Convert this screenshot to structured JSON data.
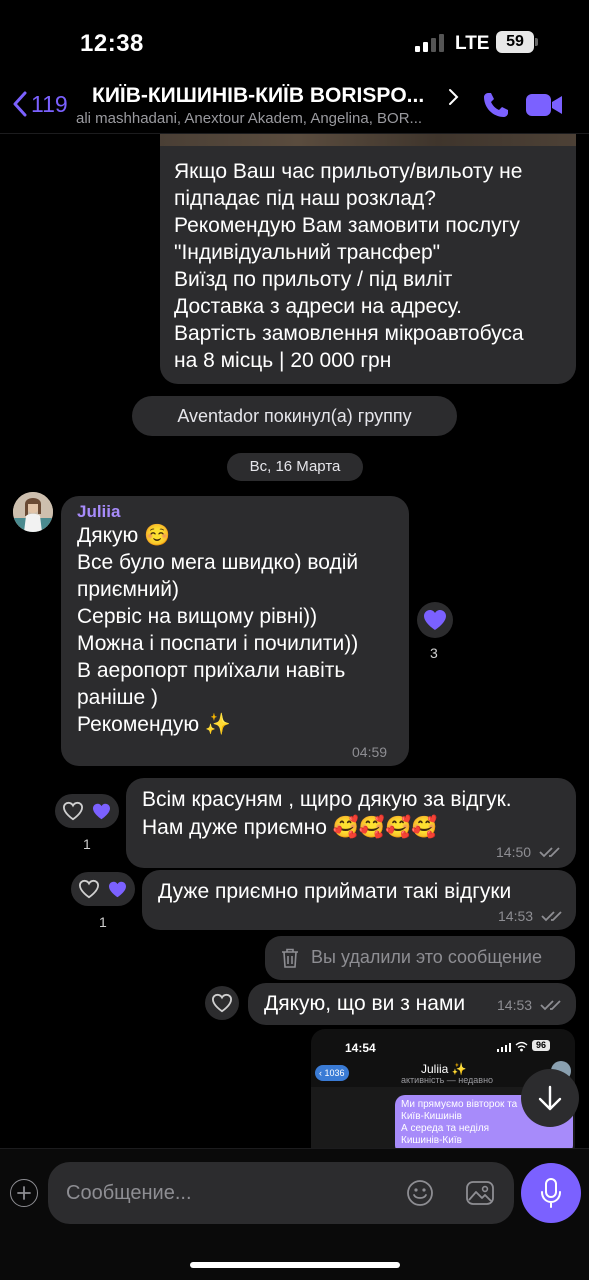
{
  "status_bar": {
    "time": "12:38",
    "network": "LTE",
    "battery": "59"
  },
  "header": {
    "back_count": "119",
    "title": "КИЇВ-КИШИНІВ-КИЇВ BORISPO...",
    "participants": "ali mashhadani, Anextour Akadem, Angelina, BOR..."
  },
  "messages": {
    "top_bubble_text": "Якщо Ваш час прильоту/вильоту не\nпідпадає під наш розклад?\nРекомендую Вам замовити послугу\n\"Індивідуальний трансфер\"\nВиїзд по прильоту / під виліт\nДоставка з адреси на адресу.\nВартість замовлення мікроавтобуса\nна 8 місць | 20 000 грн",
    "system_left": "Aventador покинул(а) группу",
    "date_divider": "Вс, 16 Марта",
    "juliia": {
      "sender": "Juliia",
      "text": "Дякую ☺️\nВсе було мега швидко) водій\nприємний)\nСервіс на вищому рівні))\nМожна і поспати і почилити))\nВ аеропорт приїхали навіть\nраніше )\nРекомендую ✨",
      "time": "04:59",
      "reaction_count": "3"
    },
    "out1": {
      "text": "Всім красуням , щиро дякую за відгук.\nНам дуже приємно 🥰🥰🥰🥰",
      "time": "14:50",
      "reaction_count": "1"
    },
    "out2": {
      "text": "Дуже приємно приймати такі відгуки",
      "time": "14:53",
      "reaction_count": "1"
    },
    "deleted": {
      "text": "Вы удалили это сообщение"
    },
    "out3": {
      "text": "Дякую, що ви з нами",
      "time": "14:53"
    },
    "screenshot_preview": {
      "time": "14:54",
      "battery": "96",
      "back_count": "1036",
      "name": "Juliia ✨",
      "status": "активність — недавно",
      "bubble_text": "Ми прямуємо вівторок та\nКиїв-Кишинів\nА середа та неділя\nКишинів-Київ"
    }
  },
  "composer": {
    "placeholder": "Сообщение..."
  },
  "colors": {
    "accent": "#7b61ff",
    "bubble": "#2c2c2e",
    "background": "#000000"
  }
}
